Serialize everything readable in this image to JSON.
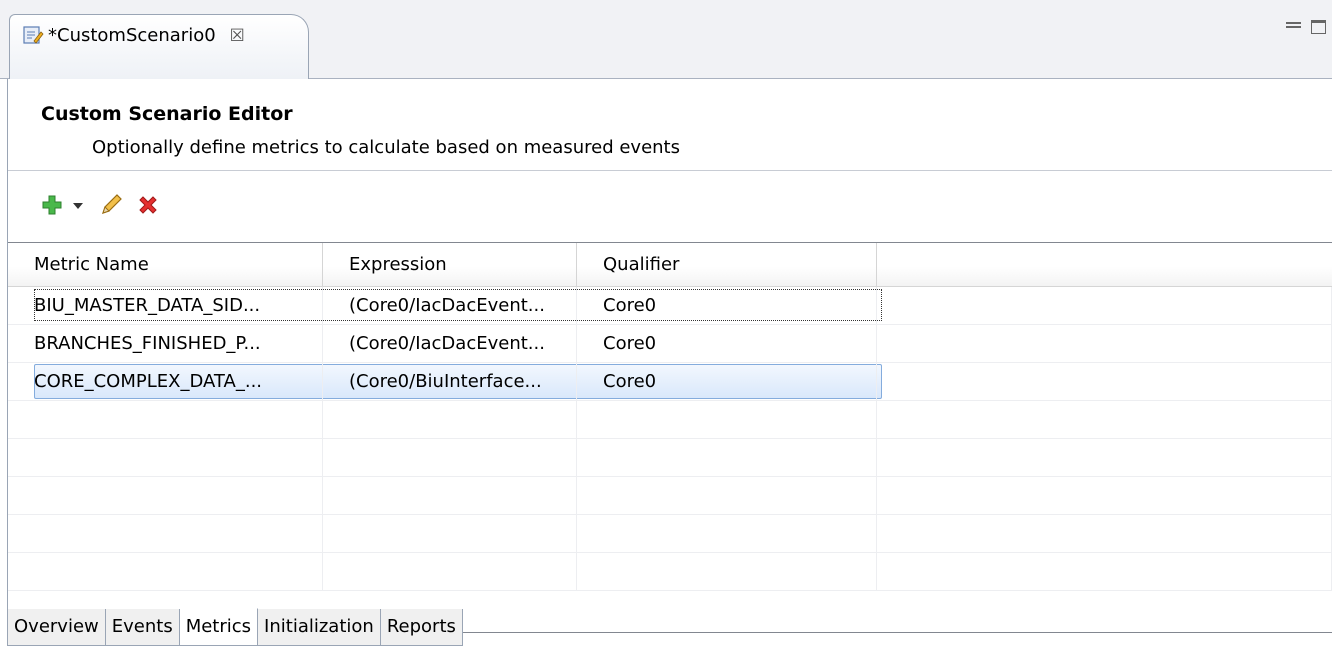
{
  "editor_tab": {
    "title": "*CustomScenario0",
    "close_glyph": "☒",
    "icon": "editor-document-icon"
  },
  "header": {
    "title": "Custom Scenario Editor",
    "description": "Optionally define metrics to calculate based on measured events"
  },
  "toolbar": {
    "add_icon": "add-icon",
    "dropdown_icon": "chevron-down-icon",
    "edit_icon": "pencil-icon",
    "delete_icon": "delete-icon"
  },
  "table": {
    "columns": [
      "Metric Name",
      "Expression",
      "Qualifier",
      ""
    ],
    "rows": [
      {
        "metric": "BIU_MASTER_DATA_SID...",
        "expression": "(Core0/IacDacEvent...",
        "qualifier": "Core0"
      },
      {
        "metric": "BRANCHES_FINISHED_P...",
        "expression": "(Core0/IacDacEvent...",
        "qualifier": "Core0"
      },
      {
        "metric": "CORE_COMPLEX_DATA_...",
        "expression": "(Core0/BiuInterface...",
        "qualifier": "Core0"
      }
    ]
  },
  "page_tabs": [
    "Overview",
    "Events",
    "Metrics",
    "Initialization",
    "Reports"
  ],
  "active_page_tab": "Metrics",
  "colors": {
    "selection": "#d9e8fb",
    "selection_border": "#84acdd",
    "add": "#3cae3c",
    "delete": "#e02020"
  }
}
